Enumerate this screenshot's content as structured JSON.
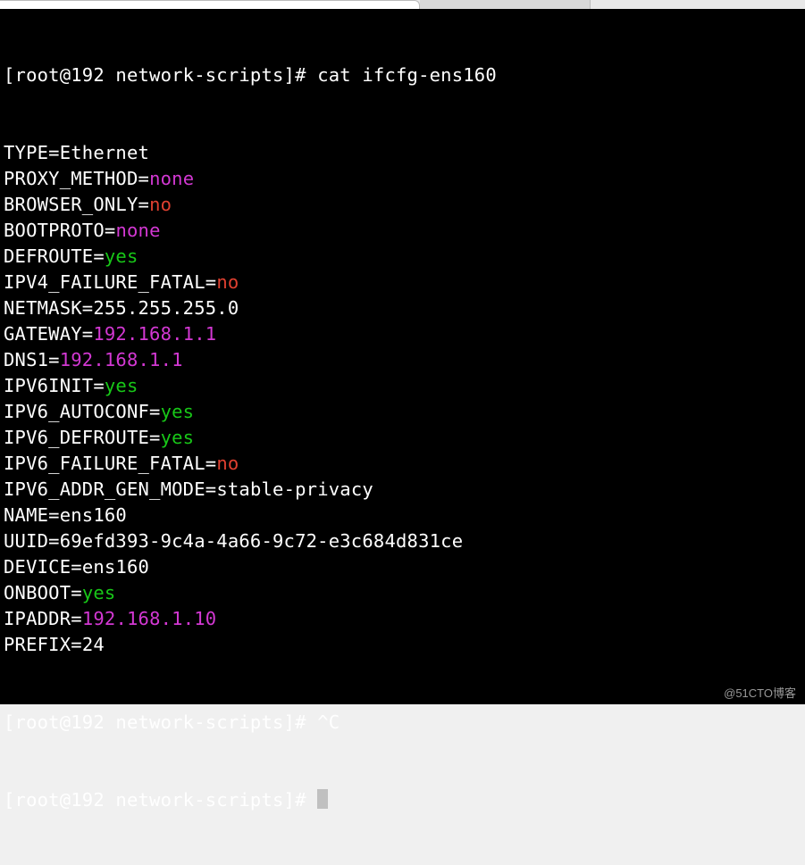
{
  "tabs": {
    "tab1": "",
    "tab2": ""
  },
  "prompt1": "[root@192 network-scripts]# ",
  "command1": "cat ifcfg-ens160",
  "lines": [
    {
      "key": "TYPE",
      "value": "Ethernet",
      "color": "white"
    },
    {
      "key": "PROXY_METHOD",
      "value": "none",
      "color": "magenta"
    },
    {
      "key": "BROWSER_ONLY",
      "value": "no",
      "color": "red"
    },
    {
      "key": "BOOTPROTO",
      "value": "none",
      "color": "magenta"
    },
    {
      "key": "DEFROUTE",
      "value": "yes",
      "color": "green"
    },
    {
      "key": "IPV4_FAILURE_FATAL",
      "value": "no",
      "color": "red"
    },
    {
      "key": "NETMASK",
      "value": "255.255.255.0",
      "color": "white"
    },
    {
      "key": "GATEWAY",
      "value": "192.168.1.1",
      "color": "magenta"
    },
    {
      "key": "DNS1",
      "value": "192.168.1.1",
      "color": "magenta"
    },
    {
      "key": "IPV6INIT",
      "value": "yes",
      "color": "green"
    },
    {
      "key": "IPV6_AUTOCONF",
      "value": "yes",
      "color": "green"
    },
    {
      "key": "IPV6_DEFROUTE",
      "value": "yes",
      "color": "green"
    },
    {
      "key": "IPV6_FAILURE_FATAL",
      "value": "no",
      "color": "red"
    },
    {
      "key": "IPV6_ADDR_GEN_MODE",
      "value": "stable-privacy",
      "color": "white"
    },
    {
      "key": "NAME",
      "value": "ens160",
      "color": "white"
    },
    {
      "key": "UUID",
      "value": "69efd393-9c4a-4a66-9c72-e3c684d831ce",
      "color": "white"
    },
    {
      "key": "DEVICE",
      "value": "ens160",
      "color": "white"
    },
    {
      "key": "ONBOOT",
      "value": "yes",
      "color": "green"
    },
    {
      "key": "IPADDR",
      "value": "192.168.1.10",
      "color": "magenta"
    },
    {
      "key": "PREFIX",
      "value": "24",
      "color": "white"
    }
  ],
  "prompt2": "[root@192 network-scripts]# ",
  "interrupt": "^C",
  "prompt3": "[root@192 network-scripts]# ",
  "watermark": "@51CTO博客"
}
